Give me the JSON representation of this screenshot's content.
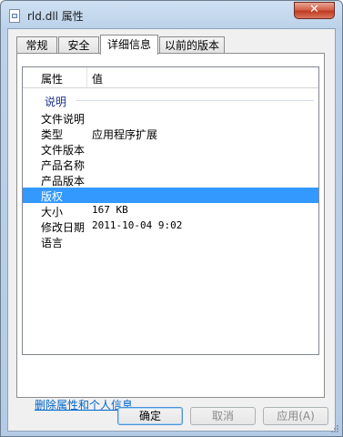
{
  "window": {
    "title": "rld.dll 属性",
    "close_glyph": "✕",
    "icon": "dll-file-icon"
  },
  "tabs": [
    {
      "label": "常规",
      "active": false
    },
    {
      "label": "安全",
      "active": false
    },
    {
      "label": "详细信息",
      "active": true
    },
    {
      "label": "以前的版本",
      "active": false
    }
  ],
  "details": {
    "columns": [
      "属性",
      "值"
    ],
    "group": "说明",
    "rows": [
      {
        "key": "文件说明",
        "value": ""
      },
      {
        "key": "类型",
        "value": "应用程序扩展"
      },
      {
        "key": "文件版本",
        "value": ""
      },
      {
        "key": "产品名称",
        "value": ""
      },
      {
        "key": "产品版本",
        "value": ""
      },
      {
        "key": "版权",
        "value": "",
        "selected": true
      },
      {
        "key": "大小",
        "value": "167 KB"
      },
      {
        "key": "修改日期",
        "value": "2011-10-04 9:02"
      },
      {
        "key": "语言",
        "value": ""
      }
    ]
  },
  "remove_link": "删除属性和个人信息",
  "buttons": {
    "ok": "确定",
    "cancel": "取消",
    "apply": "应用(A)"
  },
  "colors": {
    "selection": "#3399ff",
    "link": "#0066cc",
    "close": "#c13a22"
  }
}
